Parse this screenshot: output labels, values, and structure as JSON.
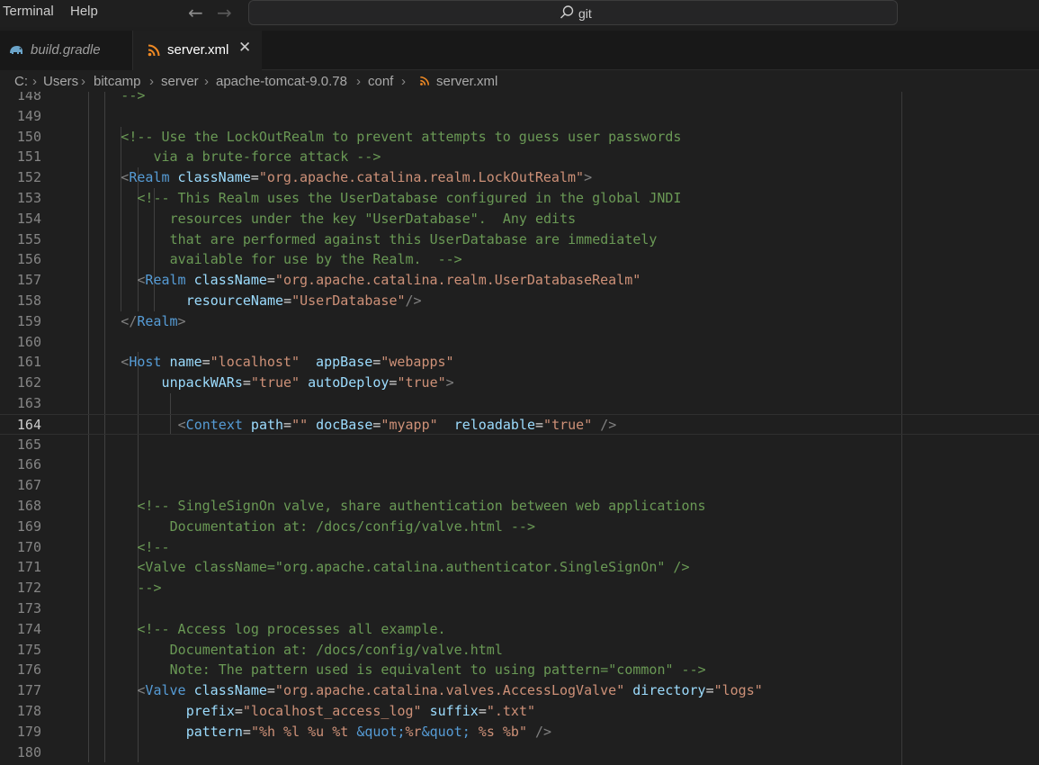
{
  "menu": {
    "terminal": "Terminal",
    "help": "Help"
  },
  "nav": {
    "back": "←",
    "forward": "→"
  },
  "search": {
    "label": "git"
  },
  "tabs": [
    {
      "label": "build.gradle",
      "icon": "gradle-elephant-icon"
    },
    {
      "label": "server.xml",
      "icon": "rss-xml-icon",
      "close": "✕"
    }
  ],
  "breadcrumb": [
    "C:",
    "Users",
    "bitcamp",
    "server",
    "apache-tomcat-9.0.78",
    "conf",
    "server.xml"
  ],
  "breadcrumb_separator": "›",
  "editor": {
    "current_line": "164",
    "lines": [
      {
        "n": "148",
        "indent": 3,
        "tokens": [
          [
            "c",
            "-->"
          ]
        ]
      },
      {
        "n": "149",
        "indent": 0,
        "tokens": []
      },
      {
        "n": "150",
        "indent": 3,
        "tokens": [
          [
            "c",
            "<!-- Use the LockOutRealm to prevent attempts to guess user passwords"
          ]
        ]
      },
      {
        "n": "151",
        "indent": 5,
        "tokens": [
          [
            "c",
            "via a brute-force attack -->"
          ]
        ]
      },
      {
        "n": "152",
        "indent": 3,
        "tokens": [
          [
            "p",
            "<"
          ],
          [
            "t",
            "Realm"
          ],
          [
            "d",
            " "
          ],
          [
            "a",
            "className"
          ],
          [
            "d",
            "="
          ],
          [
            "s",
            "\"org.apache.catalina.realm.LockOutRealm\""
          ],
          [
            "p",
            ">"
          ]
        ]
      },
      {
        "n": "153",
        "indent": 4,
        "tokens": [
          [
            "c",
            "<!-- This Realm uses the UserDatabase configured in the global JNDI"
          ]
        ]
      },
      {
        "n": "154",
        "indent": 6,
        "tokens": [
          [
            "c",
            "resources under the key \"UserDatabase\".  Any edits"
          ]
        ]
      },
      {
        "n": "155",
        "indent": 6,
        "tokens": [
          [
            "c",
            "that are performed against this UserDatabase are immediately"
          ]
        ]
      },
      {
        "n": "156",
        "indent": 6,
        "tokens": [
          [
            "c",
            "available for use by the Realm.  -->"
          ]
        ]
      },
      {
        "n": "157",
        "indent": 4,
        "tokens": [
          [
            "p",
            "<"
          ],
          [
            "t",
            "Realm"
          ],
          [
            "d",
            " "
          ],
          [
            "a",
            "className"
          ],
          [
            "d",
            "="
          ],
          [
            "s",
            "\"org.apache.catalina.realm.UserDatabaseRealm\""
          ]
        ]
      },
      {
        "n": "158",
        "indent": 7,
        "tokens": [
          [
            "a",
            "resourceName"
          ],
          [
            "d",
            "="
          ],
          [
            "s",
            "\"UserDatabase\""
          ],
          [
            "p",
            "/>"
          ]
        ]
      },
      {
        "n": "159",
        "indent": 3,
        "tokens": [
          [
            "p",
            "</"
          ],
          [
            "t",
            "Realm"
          ],
          [
            "p",
            ">"
          ]
        ]
      },
      {
        "n": "160",
        "indent": 0,
        "tokens": []
      },
      {
        "n": "161",
        "indent": 3,
        "tokens": [
          [
            "p",
            "<"
          ],
          [
            "t",
            "Host"
          ],
          [
            "d",
            " "
          ],
          [
            "a",
            "name"
          ],
          [
            "d",
            "="
          ],
          [
            "s",
            "\"localhost\""
          ],
          [
            "d",
            "  "
          ],
          [
            "a",
            "appBase"
          ],
          [
            "d",
            "="
          ],
          [
            "s",
            "\"webapps\""
          ]
        ]
      },
      {
        "n": "162",
        "indent": 5.5,
        "tokens": [
          [
            "a",
            "unpackWARs"
          ],
          [
            "d",
            "="
          ],
          [
            "s",
            "\"true\""
          ],
          [
            "d",
            " "
          ],
          [
            "a",
            "autoDeploy"
          ],
          [
            "d",
            "="
          ],
          [
            "s",
            "\"true\""
          ],
          [
            "p",
            ">"
          ]
        ]
      },
      {
        "n": "163",
        "indent": 0,
        "tokens": []
      },
      {
        "n": "164",
        "indent": 6.5,
        "tokens": [
          [
            "p",
            "<"
          ],
          [
            "t",
            "Context"
          ],
          [
            "d",
            " "
          ],
          [
            "a",
            "path"
          ],
          [
            "d",
            "="
          ],
          [
            "s",
            "\"\""
          ],
          [
            "d",
            " "
          ],
          [
            "a",
            "docBase"
          ],
          [
            "d",
            "="
          ],
          [
            "s",
            "\"myapp\""
          ],
          [
            "d",
            "  "
          ],
          [
            "a",
            "reloadable"
          ],
          [
            "d",
            "="
          ],
          [
            "s",
            "\"true\""
          ],
          [
            "d",
            " "
          ],
          [
            "p",
            "/>"
          ]
        ]
      },
      {
        "n": "165",
        "indent": 0,
        "tokens": []
      },
      {
        "n": "166",
        "indent": 0,
        "tokens": []
      },
      {
        "n": "167",
        "indent": 0,
        "tokens": []
      },
      {
        "n": "168",
        "indent": 4,
        "tokens": [
          [
            "c",
            "<!-- SingleSignOn valve, share authentication between web applications"
          ]
        ]
      },
      {
        "n": "169",
        "indent": 6,
        "tokens": [
          [
            "c",
            "Documentation at: /docs/config/valve.html -->"
          ]
        ]
      },
      {
        "n": "170",
        "indent": 4,
        "tokens": [
          [
            "c",
            "<!--"
          ]
        ]
      },
      {
        "n": "171",
        "indent": 4,
        "tokens": [
          [
            "c",
            "<Valve className=\"org.apache.catalina.authenticator.SingleSignOn\" />"
          ]
        ]
      },
      {
        "n": "172",
        "indent": 4,
        "tokens": [
          [
            "c",
            "-->"
          ]
        ]
      },
      {
        "n": "173",
        "indent": 0,
        "tokens": []
      },
      {
        "n": "174",
        "indent": 4,
        "tokens": [
          [
            "c",
            "<!-- Access log processes all example."
          ]
        ]
      },
      {
        "n": "175",
        "indent": 6,
        "tokens": [
          [
            "c",
            "Documentation at: /docs/config/valve.html"
          ]
        ]
      },
      {
        "n": "176",
        "indent": 6,
        "tokens": [
          [
            "c",
            "Note: The pattern used is equivalent to using pattern=\"common\" -->"
          ]
        ]
      },
      {
        "n": "177",
        "indent": 4,
        "tokens": [
          [
            "p",
            "<"
          ],
          [
            "t",
            "Valve"
          ],
          [
            "d",
            " "
          ],
          [
            "a",
            "className"
          ],
          [
            "d",
            "="
          ],
          [
            "s",
            "\"org.apache.catalina.valves.AccessLogValve\""
          ],
          [
            "d",
            " "
          ],
          [
            "a",
            "directory"
          ],
          [
            "d",
            "="
          ],
          [
            "s",
            "\"logs\""
          ]
        ]
      },
      {
        "n": "178",
        "indent": 7,
        "tokens": [
          [
            "a",
            "prefix"
          ],
          [
            "d",
            "="
          ],
          [
            "s",
            "\"localhost_access_log\""
          ],
          [
            "d",
            " "
          ],
          [
            "a",
            "suffix"
          ],
          [
            "d",
            "="
          ],
          [
            "s",
            "\".txt\""
          ]
        ]
      },
      {
        "n": "179",
        "indent": 7,
        "tokens": [
          [
            "a",
            "pattern"
          ],
          [
            "d",
            "="
          ],
          [
            "s",
            "\"%h %l %u %t "
          ],
          [
            "e",
            "&quot;"
          ],
          [
            "s",
            "%r"
          ],
          [
            "e",
            "&quot;"
          ],
          [
            "s",
            " %s %b\""
          ],
          [
            "d",
            " "
          ],
          [
            "p",
            "/>"
          ]
        ]
      },
      {
        "n": "180",
        "indent": 0,
        "tokens": []
      }
    ]
  }
}
